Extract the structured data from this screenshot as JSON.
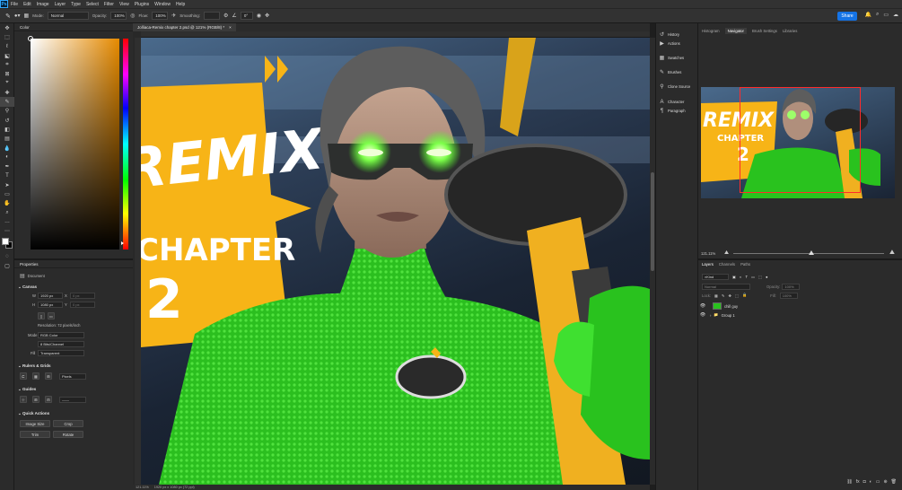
{
  "menu": {
    "items": [
      "File",
      "Edit",
      "Image",
      "Layer",
      "Type",
      "Select",
      "Filter",
      "View",
      "Plugins",
      "Window",
      "Help"
    ],
    "app_badge": "Ps"
  },
  "options": {
    "mode_label": "Mode:",
    "mode_value": "Normal",
    "opacity_label": "Opacity:",
    "opacity_value": "100%",
    "flow_label": "Flow:",
    "flow_value": "100%",
    "smoothing_label": "Smoothing:",
    "angle_value": "0°",
    "share_label": "Share"
  },
  "color_panel": {
    "tab": "Color",
    "accent": "#e68a00"
  },
  "properties": {
    "tab": "Properties",
    "document": "Document",
    "canvas": {
      "title": "Canvas",
      "w_label": "W",
      "w_value": "1920 px",
      "x_label": "X",
      "x_value": "0 px",
      "h_label": "H",
      "h_value": "1080 px",
      "y_label": "Y",
      "y_value": "0 px",
      "resolution": "Resolution: 72 pixels/inch",
      "mode_label": "Mode",
      "mode_value": "RGB Color",
      "depth_value": "8 Bits/Channel",
      "fill_label": "Fill",
      "fill_value": "Transparent"
    },
    "rulers": {
      "title": "Rulers & Grids",
      "unit": "Pixels"
    },
    "guides": {
      "title": "Guides"
    },
    "quick": {
      "title": "Quick Actions",
      "image_size": "Image Size",
      "crop": "Crop",
      "trim": "Trim",
      "rotate": "Rotate"
    }
  },
  "document": {
    "tab_title": "Jolliaca-Remix chapter 2.psd @ 121% (RGB/8) *",
    "status_zoom": "121.11%",
    "status_dims": "1920 px x 1080 px (72 ppi)"
  },
  "canvas_art": {
    "remix": "REMIX",
    "chapter": "CHAPTER",
    "chapter_num": "2"
  },
  "collapsed_panels": [
    {
      "icon": "history-icon",
      "label": "History"
    },
    {
      "icon": "actions-icon",
      "label": "Actions"
    },
    {
      "icon": "swatches-icon",
      "label": "Swatches"
    },
    {
      "icon": "brushes-icon",
      "label": "Brushes"
    },
    {
      "icon": "clone-source-icon",
      "label": "Clone Source"
    },
    {
      "icon": "character-icon",
      "label": "Character"
    },
    {
      "icon": "paragraph-icon",
      "label": "Paragraph"
    }
  ],
  "navigator": {
    "tabs": [
      "Histogram",
      "Navigator",
      "Brush Settings",
      "Libraries"
    ],
    "active": "Navigator",
    "zoom": "121.11%",
    "remix": "REMIX",
    "chapter": "CHAPTER",
    "chapter_num": "2"
  },
  "layers": {
    "tabs": [
      "Layers",
      "Channels",
      "Paths"
    ],
    "kind_label": "Kind",
    "blend": "Normal",
    "opacity_label": "Opacity:",
    "opacity_value": "100%",
    "lock_label": "Lock:",
    "fill_label": "Fill:",
    "fill_value": "100%",
    "items": [
      {
        "name": "chill guy",
        "type": "pixel"
      },
      {
        "name": "Group 1",
        "type": "group"
      }
    ]
  },
  "brand_colors": {
    "share": "#1473e6",
    "navbox": "#ff2b2b",
    "shirt": "#29c21e",
    "poster": "#f7b417"
  }
}
